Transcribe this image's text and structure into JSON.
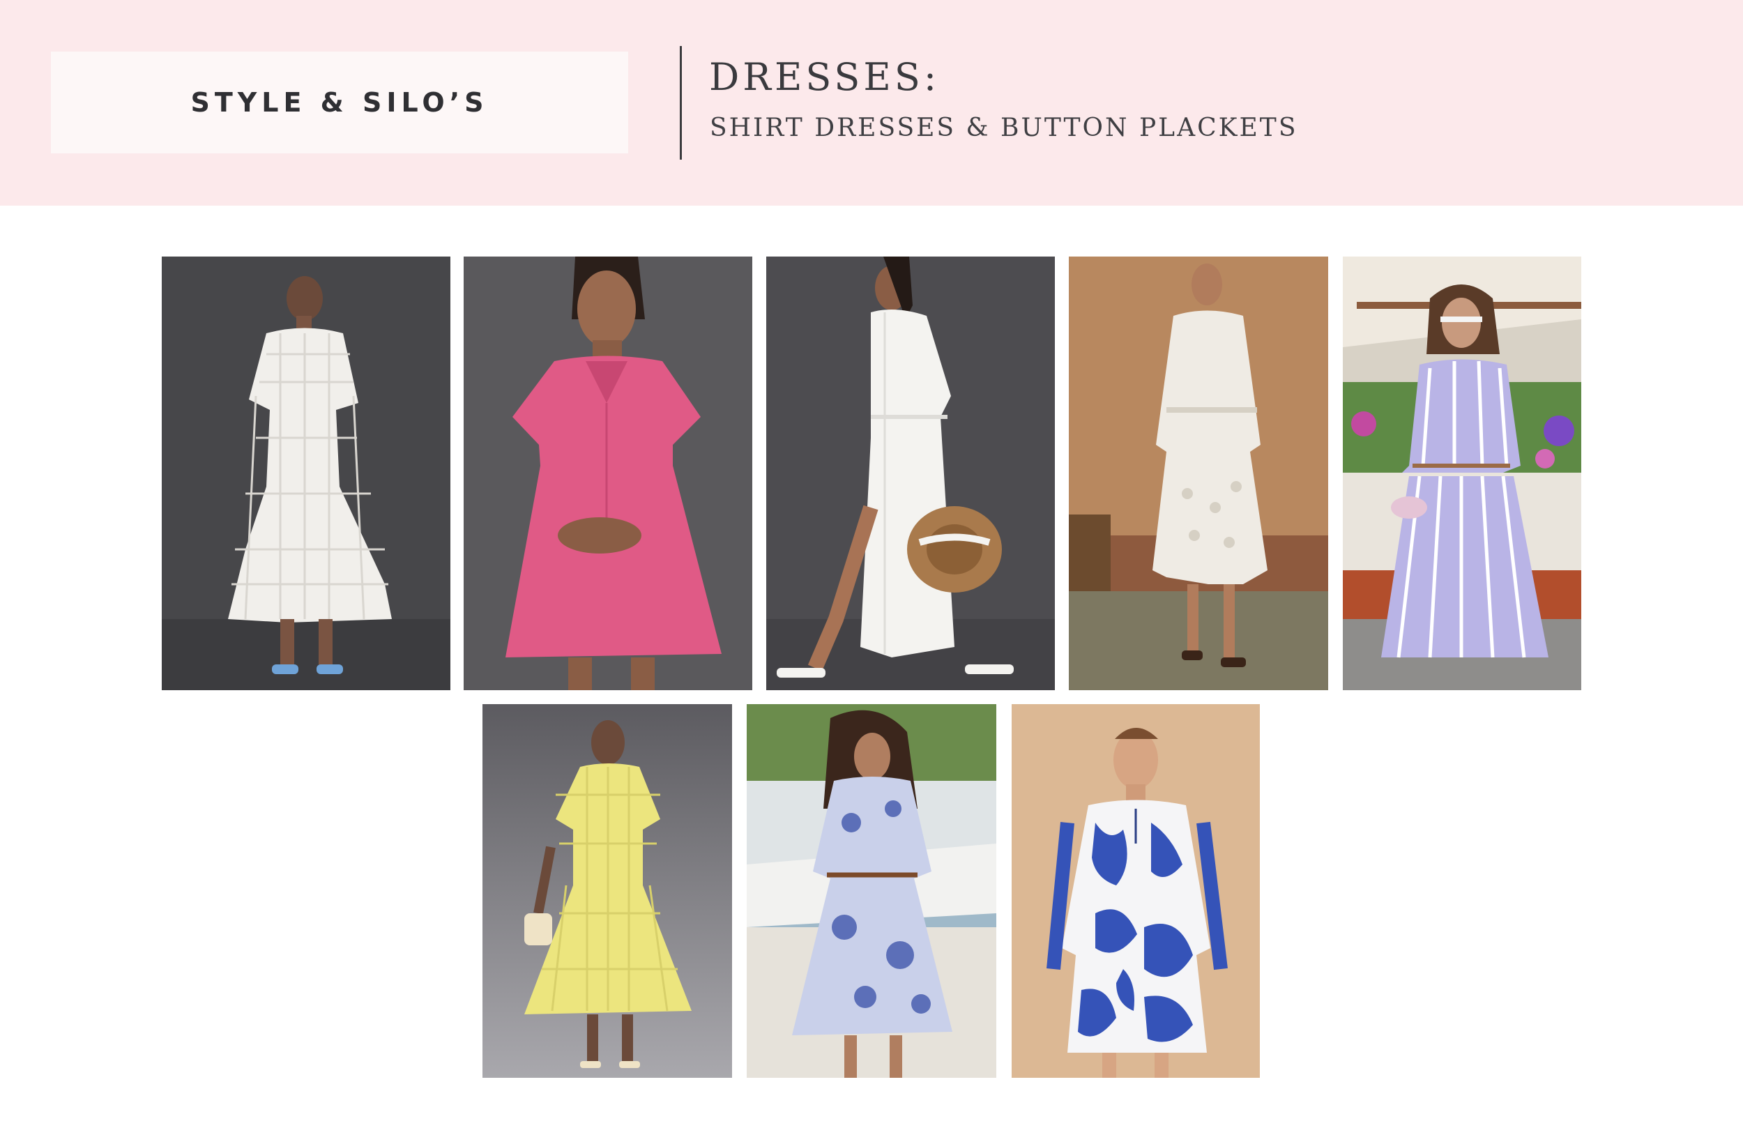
{
  "header": {
    "logo_text": "STYLE & SILO’S",
    "title": "DRESSES:",
    "subtitle": "SHIRT DRESSES & BUTTON PLACKETS"
  },
  "colors": {
    "header_background": "#fce9eb",
    "logo_box": "#fdf7f7",
    "text": "#3a3a3e"
  },
  "products": [
    {
      "name": "white-grid-puff-sleeve-shirt-dress",
      "dress_color": "#f3f1ee",
      "background": "#4a4a4d"
    },
    {
      "name": "pink-mini-shirt-dress",
      "dress_color": "#e35a86",
      "background": "#58575a"
    },
    {
      "name": "white-maxi-shirt-dress-with-hat",
      "dress_color": "#f4f3f0",
      "background": "#4d4c50"
    },
    {
      "name": "white-eyelet-belted-shirt-dress",
      "dress_color": "#efebe4",
      "background": "#b88a62"
    },
    {
      "name": "striped-shirt-and-skirt-set",
      "dress_color": "#b9b4e6",
      "background": "#8f8a80"
    },
    {
      "name": "yellow-grid-puff-sleeve-shirt-dress",
      "dress_color": "#ece57e",
      "background": "#6f6e73"
    },
    {
      "name": "blue-floral-maxi-shirt-dress",
      "dress_color": "#c9d0ea",
      "background": "#e6e4df"
    },
    {
      "name": "blue-floral-mini-tie-neck-dress",
      "dress_color": "#3553b8",
      "background": "#dcb894"
    }
  ]
}
